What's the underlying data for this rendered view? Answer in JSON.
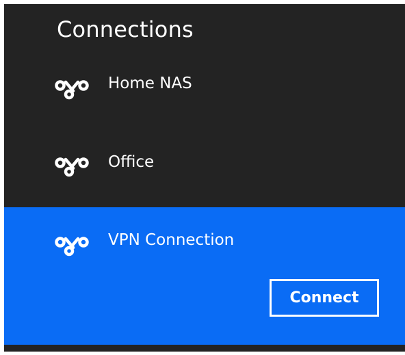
{
  "header": {
    "title": "Connections"
  },
  "connections": [
    {
      "name": "Home NAS",
      "icon": "network-connection-icon",
      "selected": false
    },
    {
      "name": "Office",
      "icon": "network-connection-icon",
      "selected": false
    },
    {
      "name": "VPN Connection",
      "icon": "network-connection-icon",
      "selected": true
    }
  ],
  "actions": {
    "connect_label": "Connect"
  },
  "colors": {
    "background": "#232323",
    "selected": "#0a6cf5",
    "text": "#ffffff"
  }
}
